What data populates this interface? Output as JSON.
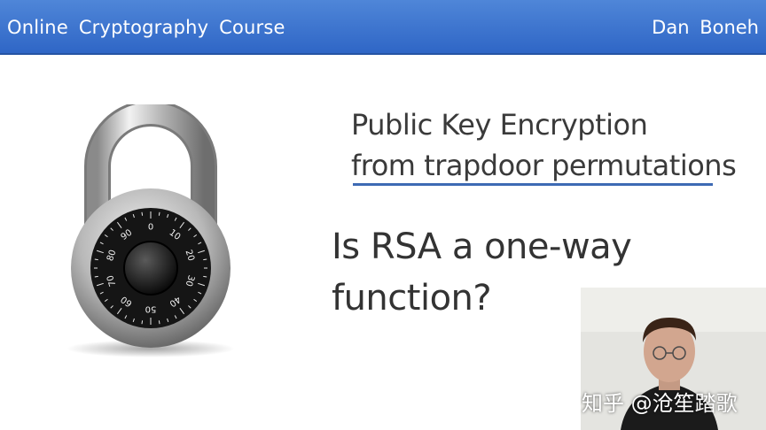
{
  "header": {
    "course_title": "Online  Cryptography  Course",
    "author": "Dan  Boneh",
    "background": "#3a73d0"
  },
  "slide": {
    "heading_line1": "Public Key Encryption",
    "heading_line2": "from trapdoor permutations",
    "question_line1": "Is RSA a one-way",
    "question_line2": "function?",
    "rule_color": "#3d6ab4"
  },
  "padlock": {
    "icon": "combination-padlock-icon",
    "dial_numbers": [
      "0",
      "10",
      "20",
      "30",
      "40",
      "50",
      "60",
      "70",
      "80",
      "90"
    ]
  },
  "video_overlay": {
    "watermark": "知乎 @沧笙踏歌"
  }
}
